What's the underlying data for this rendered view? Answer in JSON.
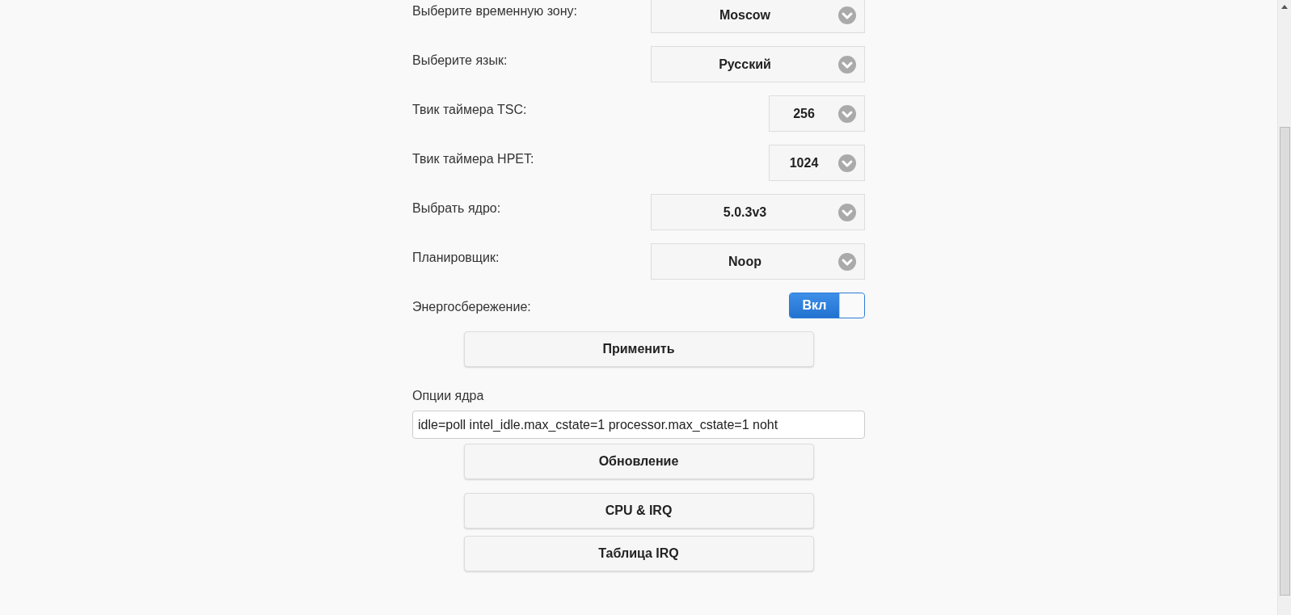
{
  "settings": [
    {
      "label": "Выберите временную зону:",
      "value": "Moscow",
      "kind": "wide"
    },
    {
      "label": "Выберите язык:",
      "value": "Русский",
      "kind": "wide"
    },
    {
      "label": "Твик таймера TSC:",
      "value": "256",
      "kind": "compact"
    },
    {
      "label": "Твик таймера HPET:",
      "value": "1024",
      "kind": "compact"
    },
    {
      "label": "Выбрать ядро:",
      "value": "5.0.3v3",
      "kind": "wide"
    },
    {
      "label": "Планировщик:",
      "value": "Noop",
      "kind": "wide"
    }
  ],
  "power_saving": {
    "label": "Энергосбережение:",
    "on_text": "Вкл",
    "on": true
  },
  "apply_button": "Применить",
  "kernel_options": {
    "label": "Опции ядра",
    "value": "idle=poll intel_idle.max_cstate=1 processor.max_cstate=1 noht"
  },
  "buttons": [
    "Обновление",
    "CPU & IRQ",
    "Таблица IRQ"
  ]
}
